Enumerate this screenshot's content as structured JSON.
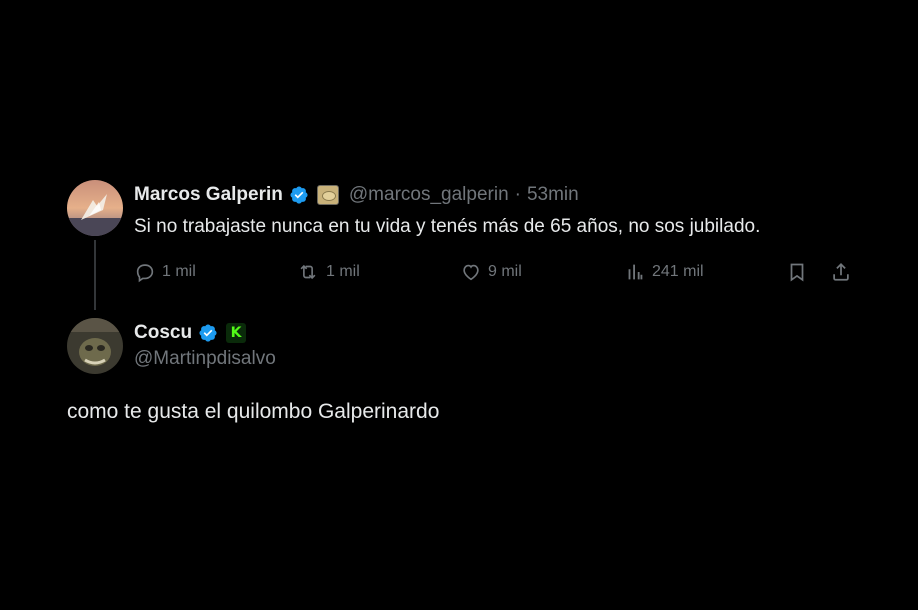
{
  "original_tweet": {
    "author_name": "Marcos Galperin",
    "handle": "@marcos_galperin",
    "separator": "·",
    "time": "53min",
    "text": "Si no trabajaste nunca en tu vida y tenés más de 65 años, no sos jubilado.",
    "stats": {
      "replies": "1 mil",
      "reposts": "1 mil",
      "likes": "9 mil",
      "views": "241 mil"
    },
    "icons": [
      "verified-badge-icon",
      "organization-badge-icon",
      "reply-icon",
      "repost-icon",
      "like-icon",
      "views-icon",
      "bookmark-icon",
      "share-icon"
    ]
  },
  "reply": {
    "author_name": "Coscu",
    "handle": "@Martinpdisalvo",
    "badge_letter": "K",
    "text": "como te gusta el quilombo Galperinardo"
  },
  "colors": {
    "background": "#000000",
    "primary_text": "#e7e9ea",
    "secondary_text": "#71767b",
    "verified_blue": "#1d9bf0",
    "kick_green": "#53fc18"
  }
}
